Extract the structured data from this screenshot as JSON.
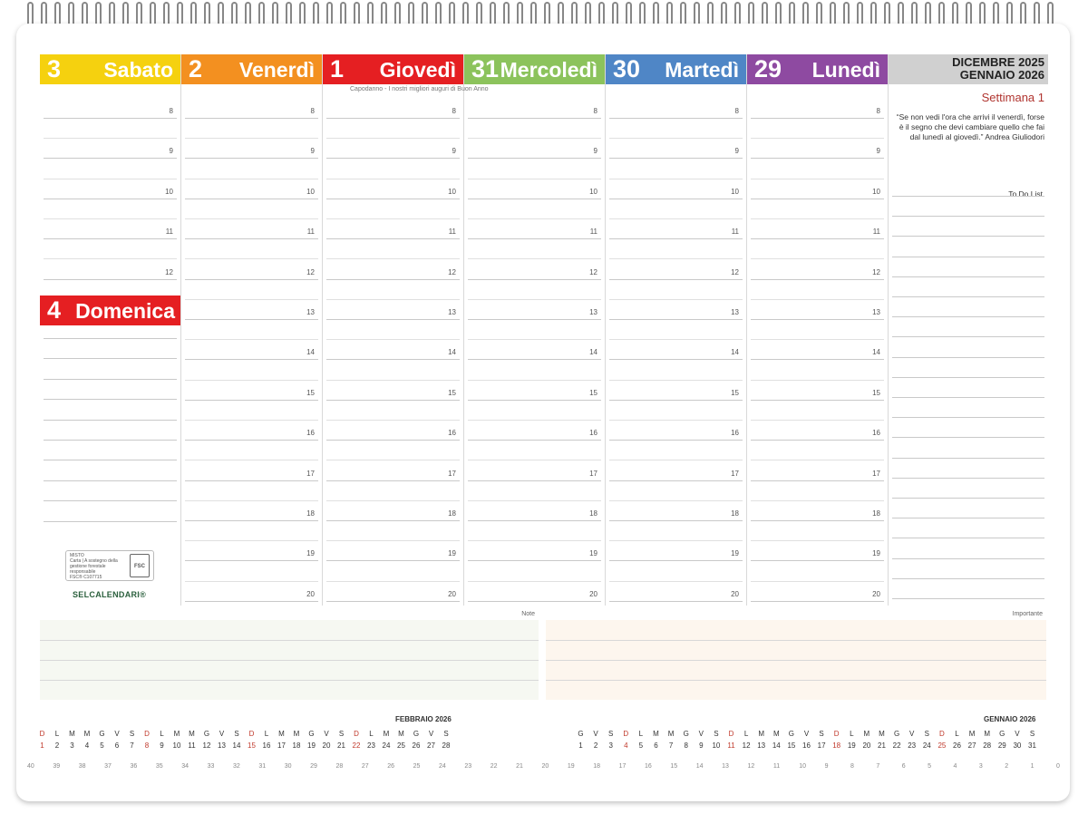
{
  "header": {
    "month_line1": "DICEMBRE 2025",
    "month_line2": "GENNAIO 2026"
  },
  "week": {
    "title": "Settimana 1",
    "quote": "“Se non vedi l'ora che arrivi il venerdì, forse è il segno che devi cambiare quello che fai dal lunedì al giovedì.” Andrea Giuliodori",
    "todo_label": "To Do List"
  },
  "days": [
    {
      "num": "3",
      "name": "Sabato",
      "color": "#f5d10f"
    },
    {
      "num": "2",
      "name": "Venerdì",
      "color": "#f39020"
    },
    {
      "num": "1",
      "name": "Giovedì",
      "color": "#e51f22"
    },
    {
      "num": "31",
      "name": "Mercoledì",
      "color": "#8cc35c"
    },
    {
      "num": "30",
      "name": "Martedì",
      "color": "#4f86c6"
    },
    {
      "num": "29",
      "name": "Lunedì",
      "color": "#8e4aa1"
    }
  ],
  "sunday": {
    "num": "4",
    "name": "Domenica",
    "color": "#e51f22"
  },
  "thursday_note": "Capodanno - I nostri migliori auguri di Buon Anno",
  "hours": [
    "8",
    "9",
    "10",
    "11",
    "12",
    "13",
    "14",
    "15",
    "16",
    "17",
    "18",
    "19",
    "20"
  ],
  "fsc": {
    "mix": "MISTO",
    "text": "Carta | A sostegno della gestione forestale responsabile",
    "code": "FSC® C107715",
    "logo": "FSC"
  },
  "brand": "SELCALENDARI®",
  "notes": {
    "note_label": "Note",
    "important_label": "Importante",
    "note_bg": "#f6f8f2",
    "important_bg": "#fdf6ee"
  },
  "mini_calendars": {
    "left": {
      "title": "FEBBRAIO 2026",
      "days": [
        "D",
        "L",
        "M",
        "M",
        "G",
        "V",
        "S",
        "D",
        "L",
        "M",
        "M",
        "G",
        "V",
        "S",
        "D",
        "L",
        "M",
        "M",
        "G",
        "V",
        "S",
        "D",
        "L",
        "M",
        "M",
        "G",
        "V",
        "S"
      ],
      "dates": [
        "1",
        "2",
        "3",
        "4",
        "5",
        "6",
        "7",
        "8",
        "9",
        "10",
        "11",
        "12",
        "13",
        "14",
        "15",
        "16",
        "17",
        "18",
        "19",
        "20",
        "21",
        "22",
        "23",
        "24",
        "25",
        "26",
        "27",
        "28"
      ]
    },
    "right": {
      "title": "GENNAIO 2026",
      "days": [
        "G",
        "V",
        "S",
        "D",
        "L",
        "M",
        "M",
        "G",
        "V",
        "S",
        "D",
        "L",
        "M",
        "M",
        "G",
        "V",
        "S",
        "D",
        "L",
        "M",
        "M",
        "G",
        "V",
        "S",
        "D",
        "L",
        "M",
        "M",
        "G",
        "V",
        "S"
      ],
      "dates": [
        "1",
        "2",
        "3",
        "4",
        "5",
        "6",
        "7",
        "8",
        "9",
        "10",
        "11",
        "12",
        "13",
        "14",
        "15",
        "16",
        "17",
        "18",
        "19",
        "20",
        "21",
        "22",
        "23",
        "24",
        "25",
        "26",
        "27",
        "28",
        "29",
        "30",
        "31"
      ]
    }
  },
  "ruler": [
    "0",
    "1",
    "2",
    "3",
    "4",
    "5",
    "6",
    "7",
    "8",
    "9",
    "10",
    "11",
    "12",
    "13",
    "14",
    "15",
    "16",
    "17",
    "18",
    "19",
    "20",
    "21",
    "22",
    "23",
    "24",
    "25",
    "26",
    "27",
    "28",
    "29",
    "30",
    "31",
    "32",
    "33",
    "34",
    "35",
    "36",
    "37",
    "38",
    "39",
    "40"
  ],
  "colors": {
    "holiday": "#c0392b",
    "accent": "#b0342f"
  }
}
